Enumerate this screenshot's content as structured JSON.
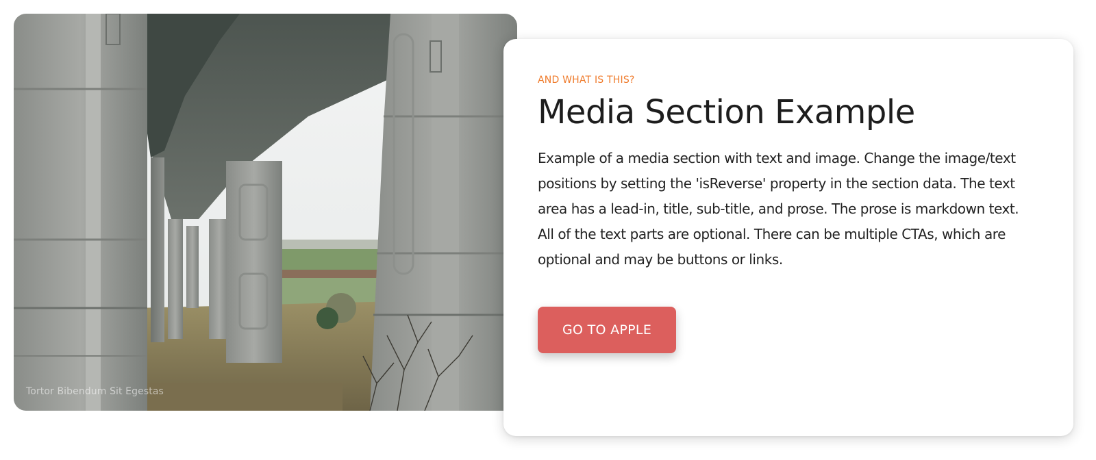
{
  "media": {
    "caption": "Tortor Bibendum Sit Egestas",
    "image_description": "Concrete highway bridge pillars with green fields in the background"
  },
  "content": {
    "lead_in": "AND WHAT IS THIS?",
    "title": "Media Section Example",
    "prose": "Example of a media section with text and image. Change the image/text positions by setting the 'isReverse' property in the section data. The text area has a lead-in, title, sub-title, and prose. The prose is markdown text. All of the text parts are optional. There can be multiple CTAs, which are optional and may be buttons or links.",
    "cta_label": "GO TO APPLE"
  },
  "colors": {
    "lead_in": "#ef7a2a",
    "cta_background": "#dc5f5d",
    "cta_text": "#ffffff",
    "title_text": "#1d1d1d"
  }
}
